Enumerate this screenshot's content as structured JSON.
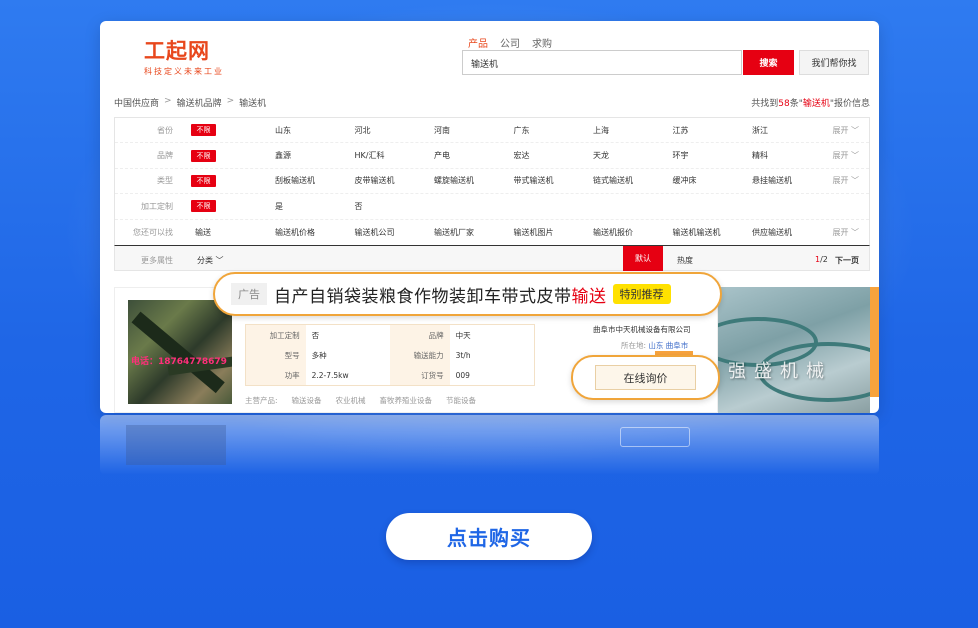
{
  "header": {
    "logo_name": "工起网",
    "logo_slogan": "科技定义未来工业",
    "search_tabs": [
      "产品",
      "公司",
      "求购"
    ],
    "search_value": "输送机",
    "search_button": "搜索",
    "help_button": "我们帮你找"
  },
  "breadcrumb": {
    "items": [
      "中国供应商",
      "输送机品牌",
      "输送机"
    ],
    "sep": ">",
    "result_prefix": "共找到",
    "result_count": "58",
    "result_mid": "条\"",
    "result_keyword": "输送机",
    "result_suffix": "\"报价信息"
  },
  "filters": {
    "any_label": "不限",
    "more_label": "展开",
    "rows": [
      {
        "label": "省份",
        "options": [
          "山东",
          "河北",
          "河南",
          "广东",
          "上海",
          "江苏",
          "浙江"
        ]
      },
      {
        "label": "品牌",
        "options": [
          "鑫源",
          "HK/汇科",
          "产电",
          "宏达",
          "天龙",
          "环宇",
          "精科"
        ]
      },
      {
        "label": "类型",
        "options": [
          "刮板输送机",
          "皮带输送机",
          "螺旋输送机",
          "带式输送机",
          "链式输送机",
          "缓冲床",
          "悬挂输送机"
        ]
      },
      {
        "label": "加工定制",
        "options": [
          "是",
          "否"
        ]
      },
      {
        "label": "您还可以找",
        "options": [
          "输送",
          "输送机价格",
          "输送机公司",
          "输送机厂家",
          "输送机图片",
          "输送机报价",
          "输送机输送机",
          "供应输送机"
        ]
      }
    ]
  },
  "sortbar": {
    "label": "更多属性",
    "category": "分类",
    "default": "默认",
    "hot": "热度",
    "page_current": "1",
    "page_total": "/2",
    "next": "下一页"
  },
  "product": {
    "phone": "电话：18764778679",
    "specs": [
      {
        "k1": "加工定制",
        "v1": "否",
        "k2": "品牌",
        "v2": "中天"
      },
      {
        "k1": "型号",
        "v1": "多种",
        "k2": "输送能力",
        "v2": "3t/h"
      },
      {
        "k1": "功率",
        "v1": "2.2-7.5kw",
        "k2": "订货号",
        "v2": "009"
      }
    ],
    "main_label": "主营产品:",
    "main_items": [
      "输送设备",
      "农业机械",
      "畜牧养殖业设备",
      "节能设备"
    ],
    "company": "曲阜市中天机械设备有限公司",
    "location_label": "所在地:",
    "location_value": "山东 曲阜市",
    "right_watermark": "强盛机械"
  },
  "ad": {
    "tag": "广告",
    "text_main": "自产自销袋装粮食作物装卸车带式皮带",
    "text_red": "输送",
    "badge": "特别推荐"
  },
  "inquiry_button": "在线询价",
  "cta_button": "点击购买",
  "colors": {
    "brand_red": "#e60012",
    "logo_orange": "#e8471c",
    "background_blue": "#1f66e6",
    "highlight_border": "#f0a53a",
    "badge_yellow": "#ffe100"
  }
}
